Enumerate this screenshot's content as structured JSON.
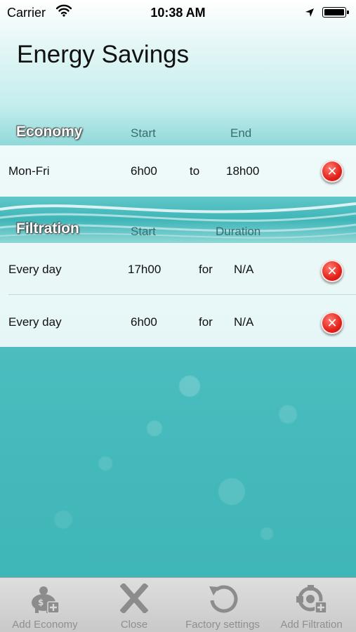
{
  "status_bar": {
    "carrier": "Carrier",
    "time": "10:38 AM"
  },
  "page": {
    "title": "Energy Savings"
  },
  "economy": {
    "title": "Economy",
    "col_start": "Start",
    "col_end": "End",
    "rows": [
      {
        "days": "Mon-Fri",
        "start": "6h00",
        "connector": "to",
        "end": "18h00"
      }
    ]
  },
  "filtration": {
    "title": "Filtration",
    "col_start": "Start",
    "col_duration": "Duration",
    "rows": [
      {
        "days": "Every day",
        "start": "17h00",
        "connector": "for",
        "duration": "N/A"
      },
      {
        "days": "Every day",
        "start": "6h00",
        "connector": "for",
        "duration": "N/A"
      }
    ]
  },
  "tab_bar": {
    "items": [
      {
        "label": "Add Economy",
        "icon": "piggy-bank-add-icon"
      },
      {
        "label": "Close",
        "icon": "close-x-icon"
      },
      {
        "label": "Factory settings",
        "icon": "reset-arrow-icon"
      },
      {
        "label": "Add Filtration",
        "icon": "pump-add-icon"
      }
    ]
  },
  "colors": {
    "water": "#3db5b7",
    "delete_red": "#e3221a",
    "tab_bar": "#d6d6d6",
    "tab_label": "#8f8f8f"
  }
}
